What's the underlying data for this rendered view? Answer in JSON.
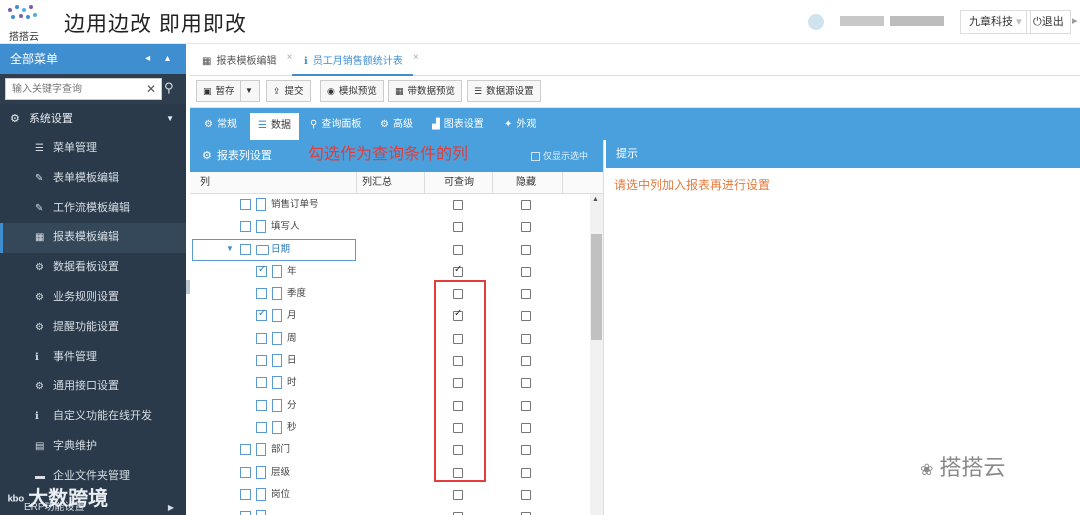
{
  "header": {
    "logo_text": "搭搭云",
    "slogan": "边用边改  即用即改",
    "company": "九章科技",
    "logout": "退出",
    "more": "▸"
  },
  "sidebar": {
    "title": "全部菜单",
    "controls": "◂ ▴",
    "search": {
      "placeholder": "输入关键字查询",
      "clear": "✕",
      "icon": "search-icon"
    },
    "group": "系统设置",
    "items": [
      {
        "label": "菜单管理",
        "icon": "list-icon"
      },
      {
        "label": "表单模板编辑",
        "icon": "edit-icon"
      },
      {
        "label": "工作流模板编辑",
        "icon": "edit-icon"
      },
      {
        "label": "报表模板编辑",
        "icon": "table-icon",
        "active": true
      },
      {
        "label": "数据看板设置",
        "icon": "gear-icon"
      },
      {
        "label": "业务规则设置",
        "icon": "gear-icon"
      },
      {
        "label": "提醒功能设置",
        "icon": "gear-icon"
      },
      {
        "label": "事件管理",
        "icon": "info-icon"
      },
      {
        "label": "通用接口设置",
        "icon": "gear-icon"
      },
      {
        "label": "自定义功能在线开发",
        "icon": "info-icon"
      },
      {
        "label": "字典维护",
        "icon": "dict-icon"
      },
      {
        "label": "企业文件夹管理",
        "icon": "folder-icon"
      }
    ],
    "bottom_item": "ERP功能设置"
  },
  "tabs": [
    {
      "label": "报表模板编辑",
      "icon": "table-icon",
      "active": false
    },
    {
      "label": "员工月销售额统计表",
      "icon": "info-icon",
      "active": true
    }
  ],
  "toolbar": {
    "buttons": [
      {
        "label": "暂存",
        "icon": "save-icon"
      },
      {
        "label": "提交",
        "icon": "upload-icon"
      },
      {
        "label": "模拟预览",
        "icon": "eye-icon"
      },
      {
        "label": "带数据预览",
        "icon": "table-icon"
      },
      {
        "label": "数据源设置",
        "icon": "database-icon"
      }
    ]
  },
  "config_tabs": [
    {
      "label": "常规",
      "icon": "gear-icon"
    },
    {
      "label": "数据",
      "icon": "database-icon",
      "active": true
    },
    {
      "label": "查询面板",
      "icon": "search-icon"
    },
    {
      "label": "高级",
      "icon": "gears-icon"
    },
    {
      "label": "图表设置",
      "icon": "chart-icon"
    },
    {
      "label": "外观",
      "icon": "magic-icon"
    }
  ],
  "column_panel": {
    "title": "报表列设置",
    "annotation": "勾选作为查询条件的列",
    "only_selected": "仅显示选中",
    "headers": {
      "col": "列",
      "sum": "列汇总",
      "query": "可查询",
      "hidden": "隐藏"
    },
    "rows": [
      {
        "name": "销售订单号",
        "level": 1,
        "checked": false,
        "query": false
      },
      {
        "name": "填写人",
        "level": 1,
        "checked": false,
        "query": false
      },
      {
        "name": "日期",
        "level": 1,
        "group": true,
        "checked": false,
        "query": false
      },
      {
        "name": "年",
        "level": 2,
        "checked": true,
        "query": true
      },
      {
        "name": "季度",
        "level": 2,
        "checked": false,
        "query": false
      },
      {
        "name": "月",
        "level": 2,
        "checked": true,
        "query": true
      },
      {
        "name": "周",
        "level": 2,
        "checked": false,
        "query": false
      },
      {
        "name": "日",
        "level": 2,
        "checked": false,
        "query": false
      },
      {
        "name": "时",
        "level": 2,
        "checked": false,
        "query": false
      },
      {
        "name": "分",
        "level": 2,
        "checked": false,
        "query": false
      },
      {
        "name": "秒",
        "level": 2,
        "checked": false,
        "query": false
      },
      {
        "name": "部门",
        "level": 1,
        "checked": false,
        "query": false
      },
      {
        "name": "层级",
        "level": 1,
        "checked": false,
        "query": false
      },
      {
        "name": "岗位",
        "level": 1,
        "checked": false,
        "query": false
      },
      {
        "name": "",
        "level": 1,
        "checked": false,
        "query": false
      }
    ]
  },
  "tip_panel": {
    "title": "提示",
    "message": "请选中列加入报表再进行设置"
  },
  "watermarks": {
    "wechat": "搭搭云",
    "bottom_left": "大数跨境",
    "bottom_left_mark": "ᵏᵇᵒ"
  }
}
